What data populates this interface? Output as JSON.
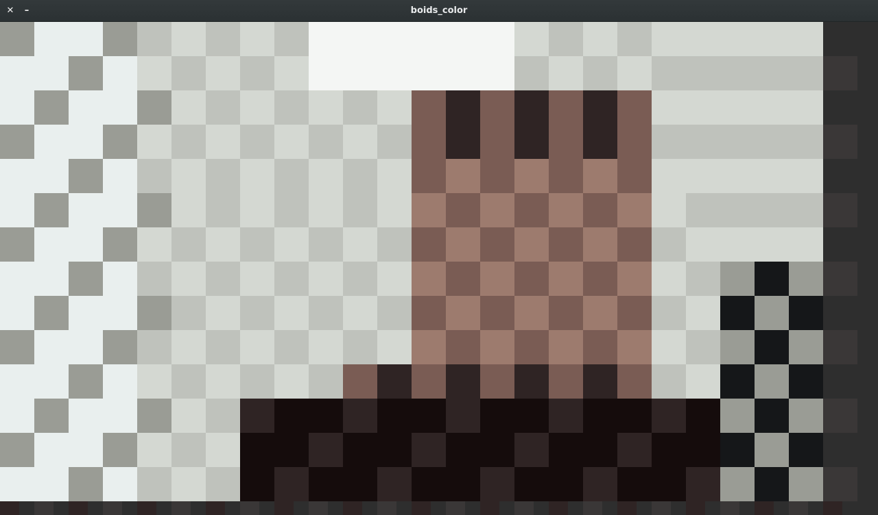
{
  "window": {
    "title": "boids_color",
    "close_glyph": "✕",
    "minimize_glyph": "–"
  },
  "canvas": {
    "description_icon": "video-mosaic",
    "palette": {
      "bright_wall": "#e9efee",
      "light_wall": "#d4d8d2",
      "mid_wall": "#bfc2bc",
      "shadow_wall": "#9a9c95",
      "blind_dark": "#5f625e",
      "skin": "#9d7b6e",
      "skin_dark": "#7a5c54",
      "hair": "#2f2424",
      "very_dark": "#150c0c",
      "window_light": "#f4f6f4",
      "background": "#2e2e2e",
      "shade_dark": "#3a3737",
      "blind_black": "#151719"
    }
  }
}
